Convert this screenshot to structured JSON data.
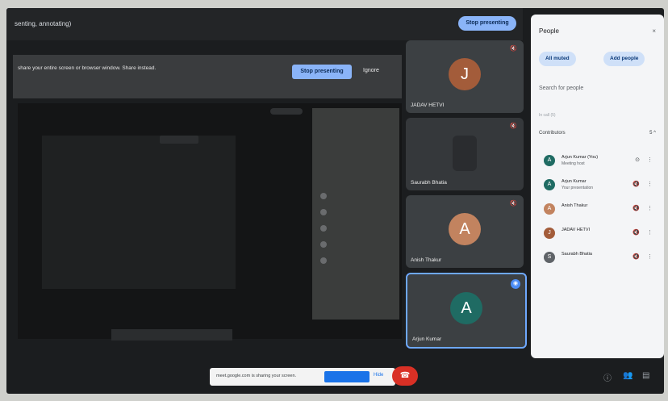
{
  "topbar": {
    "title": "senting, annotating)",
    "stop_label": "Stop presenting"
  },
  "share_banner": {
    "message": "share your entire screen or browser window. Share instead.",
    "stop_label": "Stop presenting",
    "ignore_label": "Ignore"
  },
  "tiles": [
    {
      "initial": "J",
      "name": "JADAV HETVI",
      "color": "#a35c3a"
    },
    {
      "initial": "",
      "name": "Saurabh Bhatia",
      "color": "#5f6368"
    },
    {
      "initial": "A",
      "name": "Anish Thakur",
      "color": "#c2835f"
    },
    {
      "initial": "A",
      "name": "Arjun Kumar",
      "color": "#1f6b63"
    }
  ],
  "people": {
    "title": "People",
    "close": "×",
    "all_muted": "All muted",
    "add_people": "Add people",
    "search_placeholder": "Search for people",
    "section_label": "In call (5)",
    "contributors_label": "Contributors",
    "contributors_count": "5",
    "contributors_chevron": "^",
    "participants": [
      {
        "initial": "A",
        "name": "Arjun Kumar (You)",
        "sub": "Meeting host",
        "color": "#1f6b63",
        "icon": "⊙",
        "more": "⋮"
      },
      {
        "initial": "A",
        "name": "Arjun Kumar",
        "sub": "Your presentation",
        "color": "#1f6b63",
        "icon": "🔇",
        "more": "⋮"
      },
      {
        "initial": "A",
        "name": "Anish Thakur",
        "sub": "",
        "color": "#c2835f",
        "icon": "🔇",
        "more": "⋮"
      },
      {
        "initial": "J",
        "name": "JADAV HETVI",
        "sub": "",
        "color": "#a35c3a",
        "icon": "🔇",
        "more": "⋮"
      },
      {
        "initial": "S",
        "name": "Saurabh Bhatia",
        "sub": "",
        "color": "#5f6368",
        "icon": "🔇",
        "more": "⋮"
      }
    ]
  },
  "notice": {
    "text": "meet.google.com is sharing your screen.",
    "hide_label": "Hide"
  },
  "icons": {
    "mic_off": "🔇",
    "end_call": "☎",
    "pin": "◉"
  }
}
